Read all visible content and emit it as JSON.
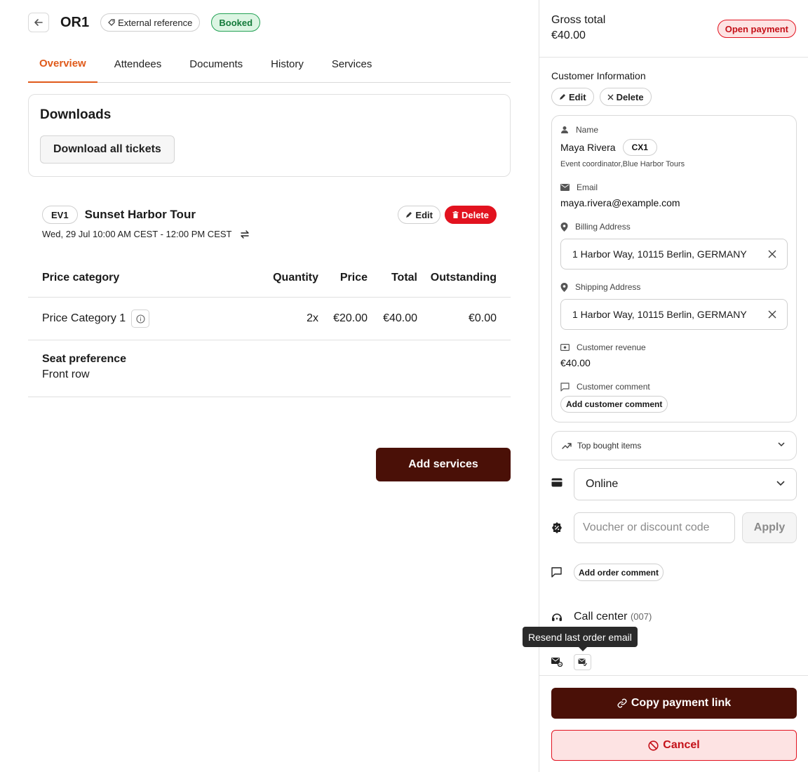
{
  "header": {
    "order_id": "OR1",
    "external_reference_label": "External reference",
    "status_badge": "Booked"
  },
  "tabs": [
    {
      "label": "Overview",
      "active": true
    },
    {
      "label": "Attendees",
      "active": false
    },
    {
      "label": "Documents",
      "active": false
    },
    {
      "label": "History",
      "active": false
    },
    {
      "label": "Services",
      "active": false
    }
  ],
  "downloads": {
    "title": "Downloads",
    "button_label": "Download all tickets"
  },
  "event": {
    "badge": "EV1",
    "name": "Sunset Harbor Tour",
    "edit_label": "Edit",
    "delete_label": "Delete",
    "datetime": "Wed, 29 Jul 10:00 AM CEST - 12:00 PM CEST"
  },
  "price_table": {
    "headers": {
      "category": "Price category",
      "quantity": "Quantity",
      "price": "Price",
      "total": "Total",
      "outstanding": "Outstanding"
    },
    "rows": [
      {
        "category": "Price Category 1",
        "quantity": "2x",
        "price": "€20.00",
        "total": "€40.00",
        "outstanding": "€0.00"
      }
    ]
  },
  "seat_preference": {
    "label": "Seat preference",
    "value": "Front row"
  },
  "add_services_label": "Add services",
  "summary": {
    "gross_label": "Gross total",
    "gross_value": "€40.00",
    "payment_status": "Open payment"
  },
  "customer": {
    "section_title": "Customer Information",
    "edit_label": "Edit",
    "delete_label": "Delete",
    "name_label": "Name",
    "name": "Maya Rivera",
    "customer_id": "CX1",
    "role": "Event coordinator,Blue Harbor Tours",
    "email_label": "Email",
    "email": "maya.rivera@example.com",
    "billing_label": "Billing Address",
    "billing_address": "1 Harbor Way, 10115 Berlin, GERMANY",
    "shipping_label": "Shipping Address",
    "shipping_address": "1 Harbor Way, 10115 Berlin, GERMANY",
    "revenue_label": "Customer revenue",
    "revenue": "€40.00",
    "comment_label": "Customer comment",
    "add_comment_label": "Add customer comment"
  },
  "top_bought_items_label": "Top bought items",
  "payment_method": "Online",
  "voucher": {
    "placeholder": "Voucher or discount code",
    "apply_label": "Apply"
  },
  "order_comment_label": "Add order comment",
  "sales_channel": {
    "name": "Call center",
    "code": "(007)"
  },
  "tooltip_text": "Resend last order email",
  "footer": {
    "copy_payment_link_label": "Copy payment link",
    "cancel_label": "Cancel"
  },
  "colors": {
    "accent_tab": "#e05a1a",
    "primary_button": "#4a1007",
    "danger": "#e2121f",
    "success": "#22a154"
  }
}
